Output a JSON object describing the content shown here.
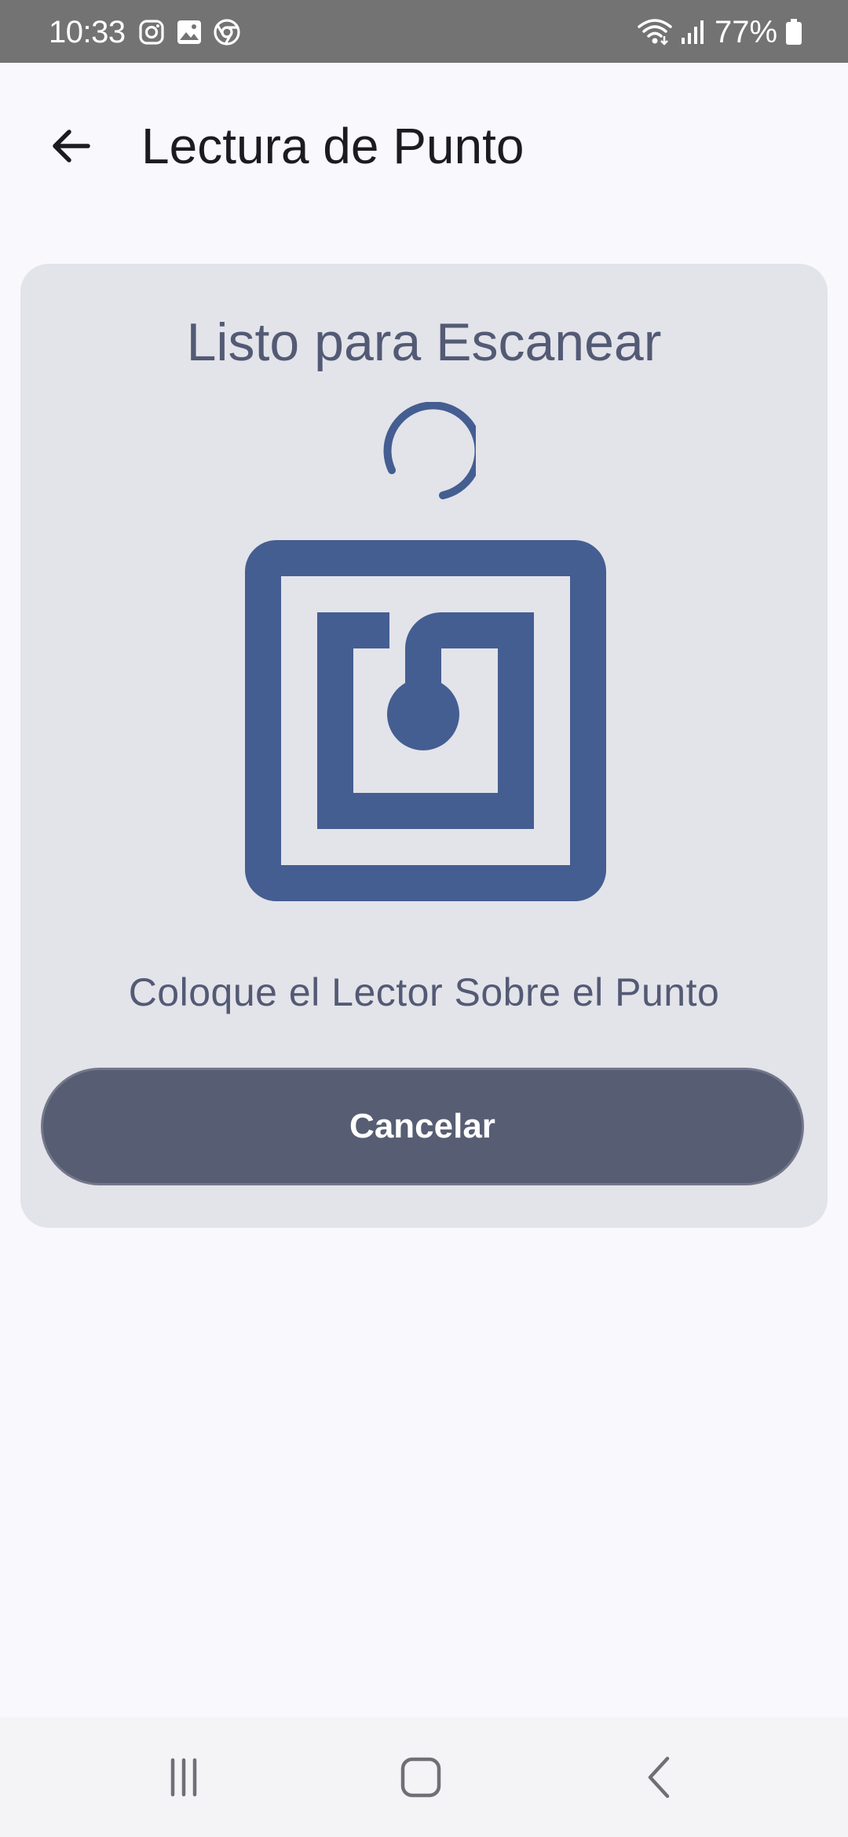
{
  "status_bar": {
    "time": "10:33",
    "battery": "77%",
    "icons": [
      "instagram-icon",
      "gallery-icon",
      "chrome-icon",
      "wifi-icon",
      "signal-icon",
      "battery-icon"
    ]
  },
  "app_bar": {
    "title": "Lectura de Punto",
    "back_icon": "arrow-back-icon"
  },
  "card": {
    "title": "Listo para Escanear",
    "instruction": "Coloque el Lector Sobre el Punto",
    "cancel_label": "Cancelar",
    "icons": [
      "loading-spinner-icon",
      "nfc-icon"
    ]
  },
  "nav_bar": {
    "icons": [
      "recent-apps-icon",
      "home-icon",
      "back-icon"
    ]
  },
  "colors": {
    "status_bar": "#737373",
    "background": "#f8f8fd",
    "card": "#e3e3ea",
    "accent": "#445e91",
    "text_muted": "#535a74",
    "button": "#575d73",
    "nav_bar": "#f4f4f7"
  }
}
